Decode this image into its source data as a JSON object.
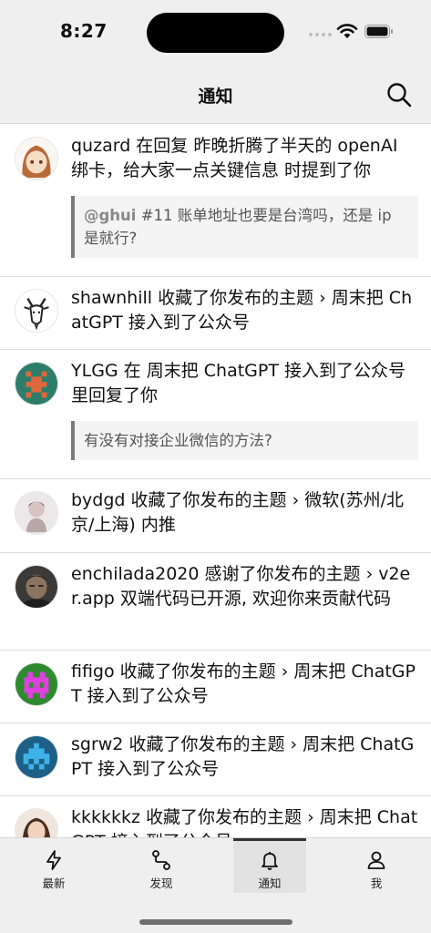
{
  "status": {
    "time": "8:27"
  },
  "nav": {
    "title": "通知"
  },
  "notifications": [
    {
      "user": "quzard",
      "action": " 在回复 ",
      "topic": "昨晚折腾了半天的 openAI 绑卡，给大家一点关键信息",
      "suffix": " 时提到了你",
      "quote_mention": "@ghui",
      "quote_text": " #11 账单地址也要是台湾吗，还是 ip 是就行?"
    },
    {
      "user": "shawnhill",
      "action": " 收藏了你发布的主题 › ",
      "topic": "周末把 ChatGPT 接入到了公众号"
    },
    {
      "user": "YLGG",
      "action": " 在 ",
      "topic": "周末把 ChatGPT 接入到了公众号",
      "suffix": " 里回复了你",
      "quote_text": "有没有对接企业微信的方法?"
    },
    {
      "user": "bydgd",
      "action": " 收藏了你发布的主题 › ",
      "topic": "微软(苏州/北京/上海) 内推"
    },
    {
      "user": "enchilada2020",
      "action": " 感谢了你发布的主题 › ",
      "topic": "v2er.app 双端代码已开源, 欢迎你来贡献代码"
    },
    {
      "user": "fifigo",
      "action": " 收藏了你发布的主题 › ",
      "topic": "周末把 ChatGPT 接入到了公众号"
    },
    {
      "user": "sgrw2",
      "action": " 收藏了你发布的主题 › ",
      "topic": "周末把 ChatGPT 接入到了公众号"
    },
    {
      "user": "kkkkkkz",
      "action": " 收藏了你发布的主题 › ",
      "topic": "周末把 ChatGPT 接入到了公众号"
    }
  ],
  "tabs": [
    {
      "label": "最新",
      "icon": "bolt-icon"
    },
    {
      "label": "发现",
      "icon": "discover-icon"
    },
    {
      "label": "通知",
      "icon": "bell-icon",
      "active": true
    },
    {
      "label": "我",
      "icon": "person-icon"
    }
  ]
}
